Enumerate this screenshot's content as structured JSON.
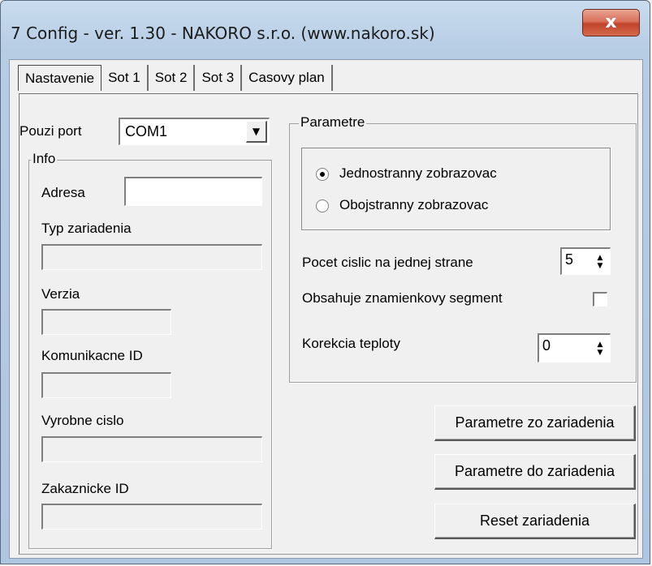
{
  "window": {
    "title": "7 Config - ver. 1.30 - NAKORO s.r.o. (www.nakoro.sk)",
    "close_glyph": "x"
  },
  "tabs": [
    {
      "label": "Nastavenie",
      "active": true
    },
    {
      "label": "Sot 1",
      "active": false
    },
    {
      "label": "Sot 2",
      "active": false
    },
    {
      "label": "Sot 3",
      "active": false
    },
    {
      "label": "Casovy plan",
      "active": false
    }
  ],
  "port": {
    "label": "Pouzi port",
    "value": "COM1"
  },
  "info": {
    "legend": "Info",
    "adresa_label": "Adresa",
    "adresa_value": "",
    "typ_label": "Typ zariadenia",
    "typ_value": "",
    "verzia_label": "Verzia",
    "verzia_value": "",
    "komunikacne_label": "Komunikacne ID",
    "komunikacne_value": "",
    "vyrobne_label": "Vyrobne cislo",
    "vyrobne_value": "",
    "zakaznicke_label": "Zakaznicke ID",
    "zakaznicke_value": ""
  },
  "parametre": {
    "legend": "Parametre",
    "radio1": "Jednostranny zobrazovac",
    "radio2": "Obojstranny zobrazovac",
    "selected": "radio1",
    "pocet_label": "Pocet cislic na jednej strane",
    "pocet_value": "5",
    "obsahuje_label": "Obsahuje znamienkovy segment",
    "obsahuje_checked": false,
    "korekcia_label": "Korekcia teploty",
    "korekcia_value": "0"
  },
  "buttons": {
    "from_device": "Parametre zo zariadenia",
    "to_device": "Parametre do zariadenia",
    "reset": "Reset zariadenia"
  },
  "colors": {
    "close_button": "#c2432a",
    "window_frame": "#b7cde4",
    "face": "#f0f0f0"
  }
}
